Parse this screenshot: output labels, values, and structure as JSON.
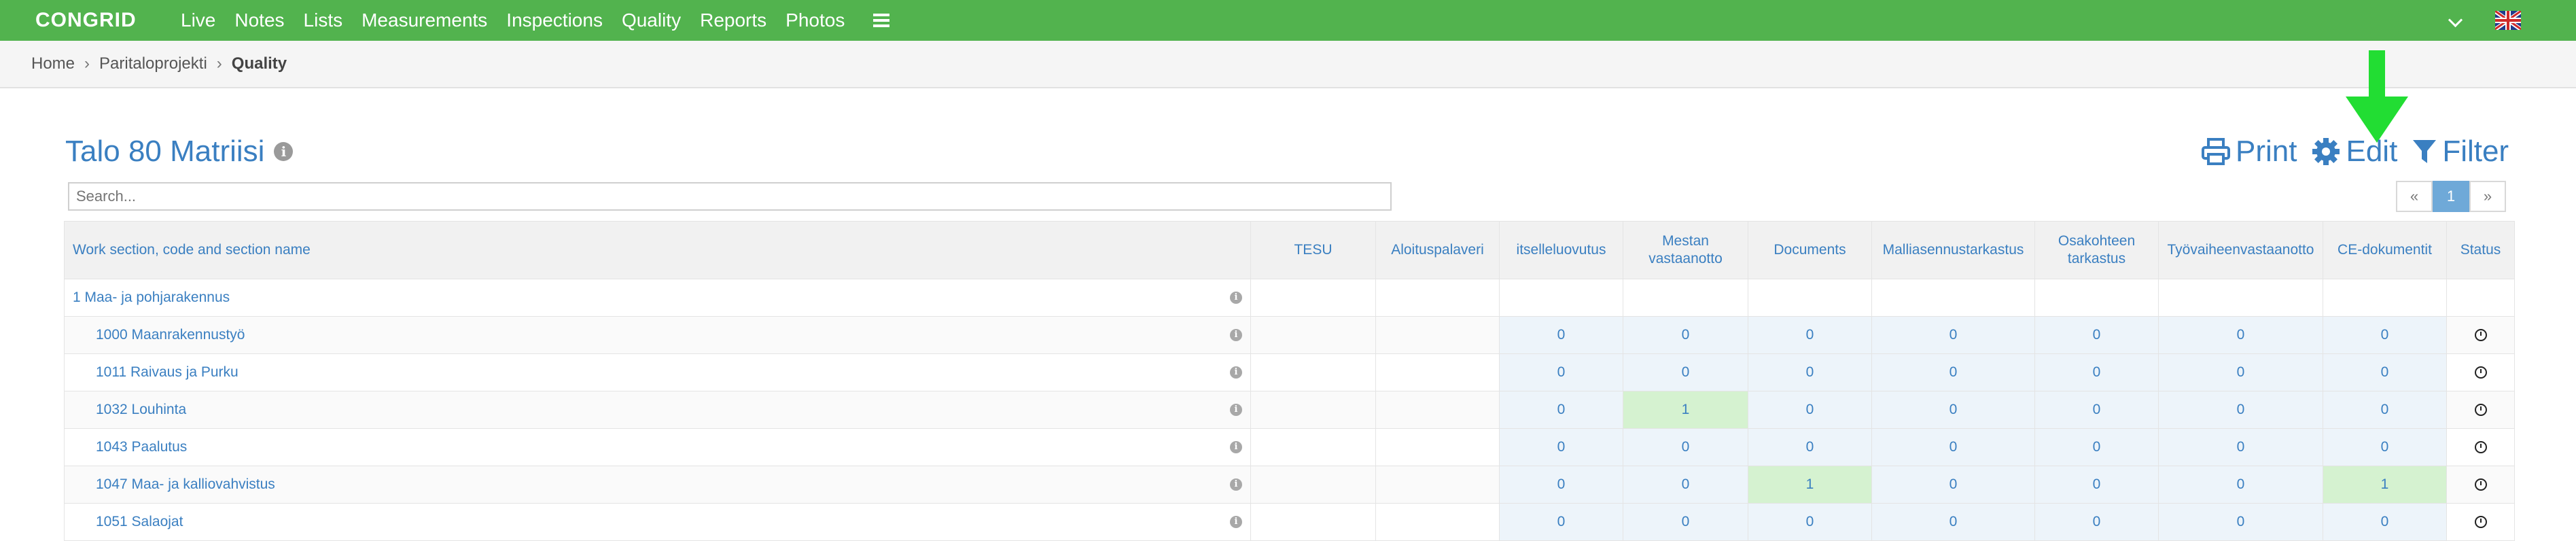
{
  "app": {
    "logo": "CONGRID",
    "nav": [
      "Live",
      "Notes",
      "Lists",
      "Measurements",
      "Inspections",
      "Quality",
      "Reports",
      "Photos"
    ]
  },
  "breadcrumb": [
    "Home",
    "Paritaloprojekti",
    "Quality"
  ],
  "page": {
    "title": "Talo 80 Matriisi",
    "actions": {
      "print": "Print",
      "edit": "Edit",
      "filter": "Filter"
    },
    "search_placeholder": "Search...",
    "pager": {
      "prev": "«",
      "current": "1",
      "next": "»"
    }
  },
  "colors": {
    "nav_green": "#52b34e",
    "link_blue": "#3a7fc1",
    "cell_blue": "#edf4fa",
    "cell_green": "#d5f2d0",
    "arrow_green": "#22dd33"
  },
  "table": {
    "headers": [
      "Work section, code and section name",
      "TESU",
      "Aloituspalaveri",
      "itselleluovutus",
      "Mestan vastaanotto",
      "Documents",
      "Malliasennustarkastus",
      "Osakohteen tarkastus",
      "Työvaiheenvastaanotto",
      "CE-dokumentit",
      "Status"
    ],
    "rows": [
      {
        "name": "1 Maa- ja pohjarakennus",
        "group": true,
        "values": [
          "",
          "",
          "",
          "",
          "",
          "",
          "",
          "",
          ""
        ],
        "highlight": []
      },
      {
        "name": "1000 Maanrakennustyö",
        "group": false,
        "values": [
          "",
          "",
          "0",
          "0",
          "0",
          "0",
          "0",
          "0",
          "0"
        ],
        "highlight": []
      },
      {
        "name": "1011 Raivaus ja Purku",
        "group": false,
        "values": [
          "",
          "",
          "0",
          "0",
          "0",
          "0",
          "0",
          "0",
          "0"
        ],
        "highlight": []
      },
      {
        "name": "1032 Louhinta",
        "group": false,
        "values": [
          "",
          "",
          "0",
          "1",
          "0",
          "0",
          "0",
          "0",
          "0"
        ],
        "highlight": [
          3
        ]
      },
      {
        "name": "1043 Paalutus",
        "group": false,
        "values": [
          "",
          "",
          "0",
          "0",
          "0",
          "0",
          "0",
          "0",
          "0"
        ],
        "highlight": []
      },
      {
        "name": "1047 Maa- ja kalliovahvistus",
        "group": false,
        "values": [
          "",
          "",
          "0",
          "0",
          "1",
          "0",
          "0",
          "0",
          "1"
        ],
        "highlight": [
          4,
          8
        ]
      },
      {
        "name": "1051 Salaojat",
        "group": false,
        "values": [
          "",
          "",
          "0",
          "0",
          "0",
          "0",
          "0",
          "0",
          "0"
        ],
        "highlight": []
      }
    ]
  }
}
